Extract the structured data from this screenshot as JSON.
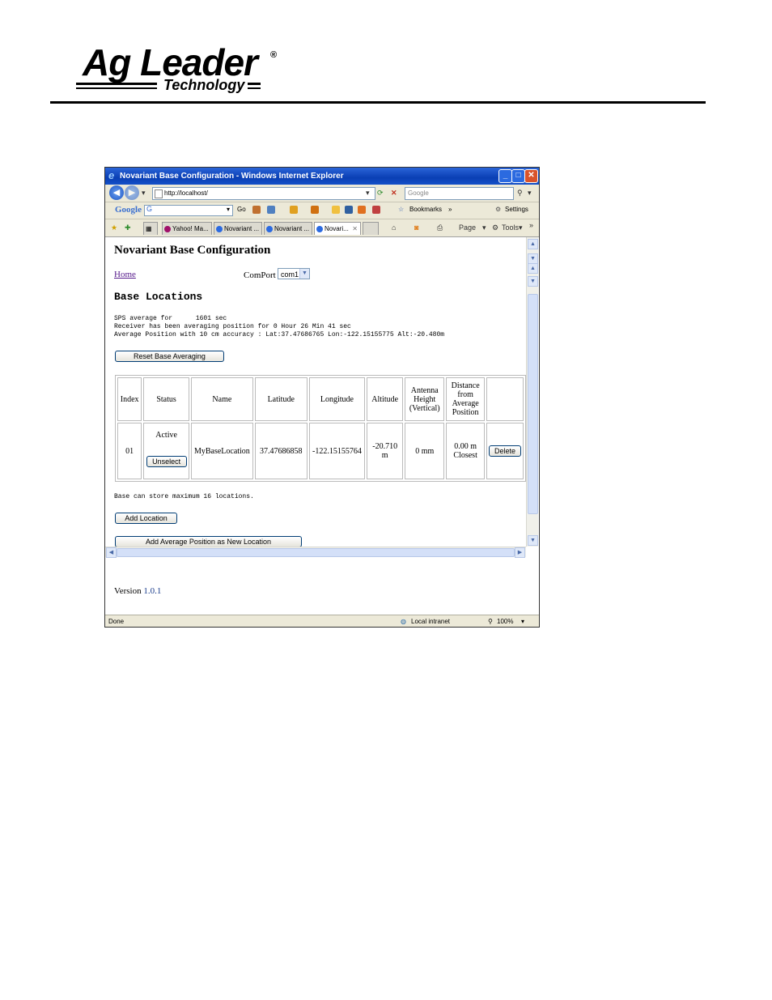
{
  "logo": {
    "main": "Ag Leader",
    "sub": "Technology",
    "reg": "®"
  },
  "browser": {
    "title": "Novariant Base Configuration - Windows Internet Explorer",
    "address": "http://localhost/",
    "search_placeholder": "Google",
    "google_logo": "Google",
    "google_box": "G",
    "toolbar": {
      "go": "Go",
      "bookmarks": "Bookmarks",
      "settings": "Settings"
    },
    "tabs": [
      {
        "label": "Yahoo! Ma..."
      },
      {
        "label": "Novariant ..."
      },
      {
        "label": "Novariant ..."
      },
      {
        "label": "Novari..."
      }
    ],
    "command": {
      "page": "Page",
      "tools": "Tools"
    },
    "status": {
      "left": "Done",
      "zone": "Local intranet",
      "zoom": "100%"
    }
  },
  "page": {
    "title": "Novariant Base Configuration",
    "home_link": "Home",
    "comport_label": "ComPort",
    "comport_value": "com1",
    "section_title": "Base Locations",
    "info_line1": "SPS average for      1601 sec",
    "info_line2": "Receiver has been averaging position for 0 Hour 26 Min 41 sec",
    "info_line3": "Average Position with 10 cm accuracy : Lat:37.47686765 Lon:-122.15155775 Alt:-20.480m",
    "reset_button": "Reset Base Averaging",
    "table": {
      "headers": [
        "Index",
        "Status",
        "Name",
        "Latitude",
        "Longitude",
        "Altitude",
        "Antenna Height (Vertical)",
        "Distance from Average Position"
      ],
      "row": {
        "index": "01",
        "status": "Active",
        "unselect": "Unselect",
        "name": "MyBaseLocation",
        "latitude": "37.47686858",
        "longitude": "-122.15155764",
        "altitude": "-20.710 m",
        "antenna": "0 mm",
        "distance": "0.00 m",
        "closest": "Closest",
        "delete": "Delete"
      }
    },
    "capacity_text": "Base can store maximum 16 locations.",
    "add_location_button": "Add Location",
    "add_average_button": "Add Average Position as New Location",
    "version_label": "Version",
    "version_number": "1.0.1"
  }
}
